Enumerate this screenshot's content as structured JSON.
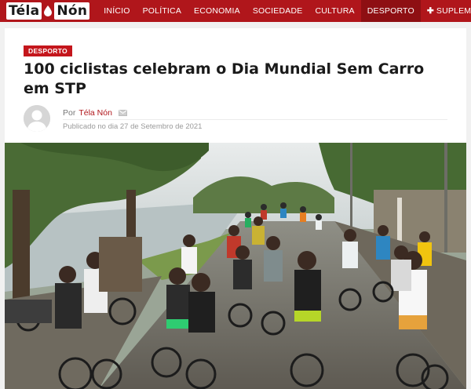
{
  "site": {
    "logo_left": "Téla",
    "logo_right": "Nón"
  },
  "nav": {
    "items": [
      {
        "label": "INÍCIO"
      },
      {
        "label": "POLÍTICA"
      },
      {
        "label": "ECONOMIA"
      },
      {
        "label": "SOCIEDADE"
      },
      {
        "label": "CULTURA"
      },
      {
        "label": "DESPORTO"
      },
      {
        "label": "SUPLEMENT"
      }
    ],
    "active": "DESPORTO"
  },
  "article": {
    "category": "DESPORTO",
    "title": "100 ciclistas celebram o Dia Mundial Sem Carro em STP",
    "by_label": "Por",
    "author": "Téla Nón",
    "published": "Publicado no dia 27 de Setembro de 2021"
  },
  "colors": {
    "brand": "#b0161b",
    "nav_active": "#8e0f13",
    "badge": "#c4161c"
  },
  "icons": {
    "mail": "mail-icon",
    "avatar": "user-avatar-placeholder",
    "plus": "plus-icon"
  }
}
